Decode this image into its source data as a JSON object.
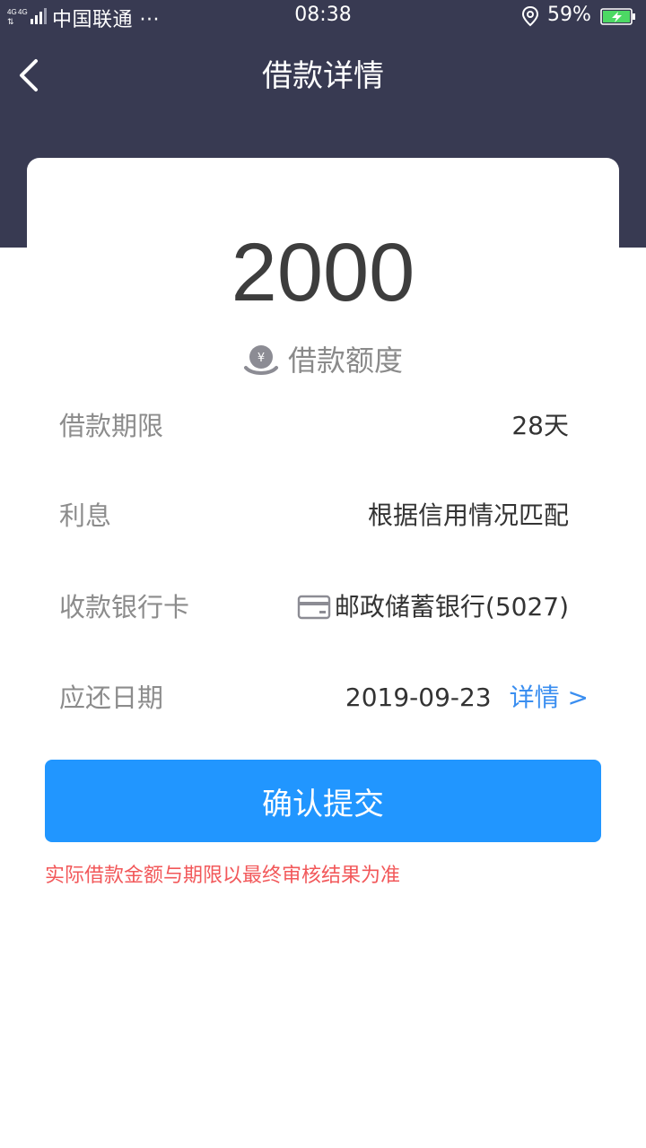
{
  "status_bar": {
    "network": "4G 4G",
    "carrier": "中国联通 ···",
    "time": "08:38",
    "battery_percent": "59%",
    "icons": [
      "signal-icon",
      "location-icon",
      "battery-charging-icon"
    ]
  },
  "nav": {
    "back_icon": "chevron-left-icon",
    "title": "借款详情"
  },
  "loan": {
    "amount": "2000",
    "amount_icon": "yen-coin-icon",
    "amount_label": "借款额度"
  },
  "rows": [
    {
      "label": "借款期限",
      "value": "28天"
    },
    {
      "label": "利息",
      "value": "根据信用情况匹配"
    },
    {
      "label": "收款银行卡",
      "value": "邮政储蓄银行(5027)",
      "icon": "bank-card-icon"
    },
    {
      "label": "应还日期",
      "value": "2019-09-23",
      "link": "详情 >"
    }
  ],
  "submit": {
    "label": "确认提交"
  },
  "notice": "实际借款金额与期限以最终审核结果为准",
  "colors": {
    "header_bg": "#383a52",
    "primary": "#2196ff",
    "link": "#3a8ef0",
    "notice": "#f2585a",
    "battery": "#4cd964"
  }
}
